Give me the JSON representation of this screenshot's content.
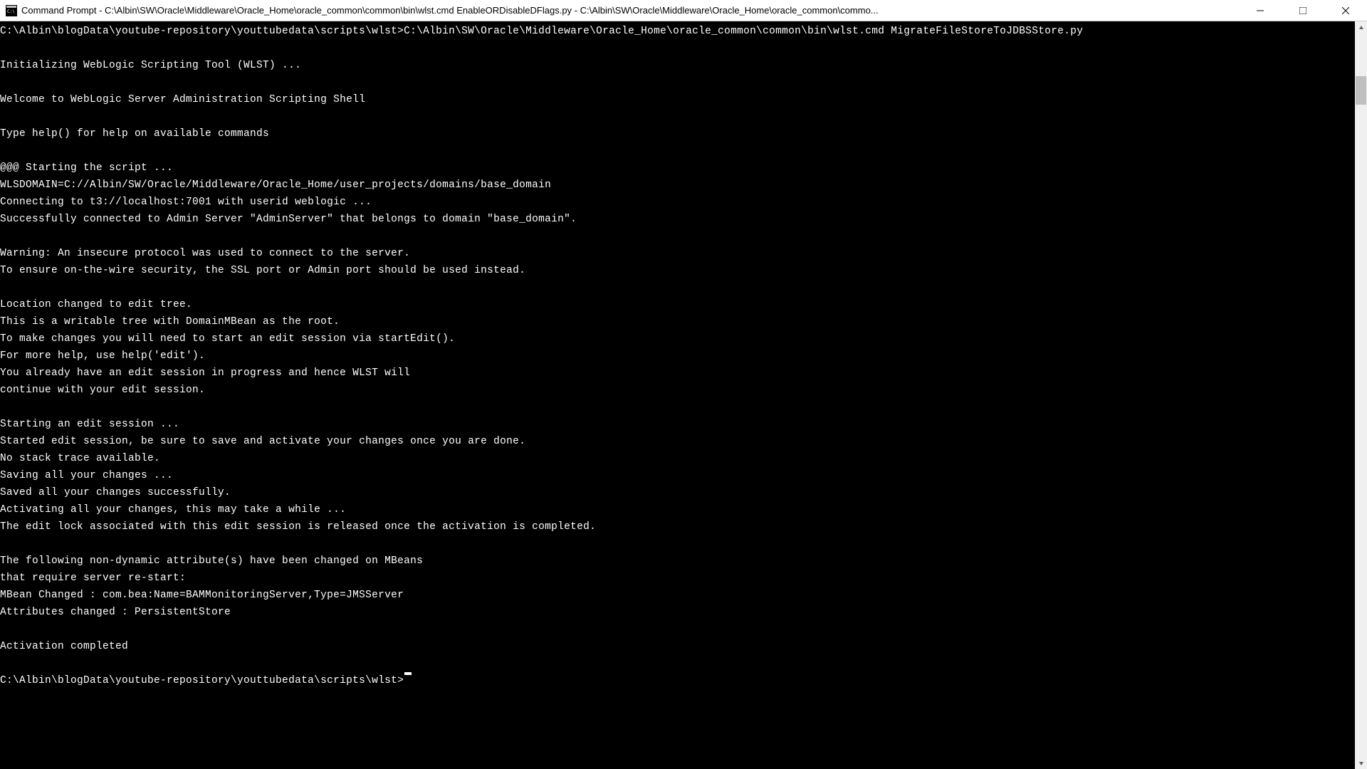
{
  "titlebar": {
    "text": "Command Prompt - C:\\Albin\\SW\\Oracle\\Middleware\\Oracle_Home\\oracle_common\\common\\bin\\wlst.cmd  EnableORDisableDFlags.py - C:\\Albin\\SW\\Oracle\\Middleware\\Oracle_Home\\oracle_common\\commo..."
  },
  "terminal": {
    "lines": [
      "C:\\Albin\\blogData\\youtube-repository\\youttubedata\\scripts\\wlst>C:\\Albin\\SW\\Oracle\\Middleware\\Oracle_Home\\oracle_common\\common\\bin\\wlst.cmd MigrateFileStoreToJDBSStore.py",
      "",
      "Initializing WebLogic Scripting Tool (WLST) ...",
      "",
      "Welcome to WebLogic Server Administration Scripting Shell",
      "",
      "Type help() for help on available commands",
      "",
      "@@@ Starting the script ...",
      "WLSDOMAIN=C://Albin/SW/Oracle/Middleware/Oracle_Home/user_projects/domains/base_domain",
      "Connecting to t3://localhost:7001 with userid weblogic ...",
      "Successfully connected to Admin Server \"AdminServer\" that belongs to domain \"base_domain\".",
      "",
      "Warning: An insecure protocol was used to connect to the server.",
      "To ensure on-the-wire security, the SSL port or Admin port should be used instead.",
      "",
      "Location changed to edit tree.",
      "This is a writable tree with DomainMBean as the root.",
      "To make changes you will need to start an edit session via startEdit().",
      "For more help, use help('edit').",
      "You already have an edit session in progress and hence WLST will",
      "continue with your edit session.",
      "",
      "Starting an edit session ...",
      "Started edit session, be sure to save and activate your changes once you are done.",
      "No stack trace available.",
      "Saving all your changes ...",
      "Saved all your changes successfully.",
      "Activating all your changes, this may take a while ...",
      "The edit lock associated with this edit session is released once the activation is completed.",
      "",
      "The following non-dynamic attribute(s) have been changed on MBeans",
      "that require server re-start:",
      "MBean Changed : com.bea:Name=BAMMonitoringServer,Type=JMSServer",
      "Attributes changed : PersistentStore",
      "",
      "Activation completed",
      ""
    ],
    "prompt": "C:\\Albin\\blogData\\youtube-repository\\youttubedata\\scripts\\wlst>"
  }
}
